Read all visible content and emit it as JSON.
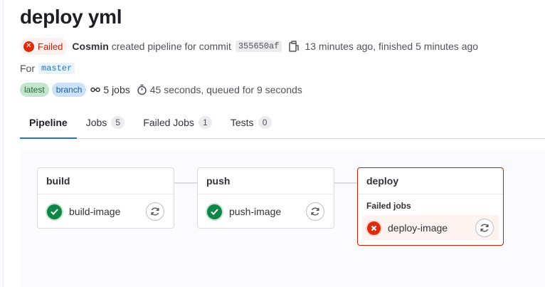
{
  "pipeline": {
    "title": "deploy yml",
    "status_label": "Failed",
    "author": "Cosmin",
    "action_text": "created pipeline for commit",
    "commit_sha": "355650af",
    "time_text": "13 minutes ago, finished 5 minutes ago",
    "for_label": "For",
    "ref": "master",
    "badges": [
      "latest",
      "branch"
    ],
    "jobs_count_text": "5 jobs",
    "duration_text": "45 seconds, queued for 9 seconds"
  },
  "tabs": [
    {
      "label": "Pipeline",
      "count": null,
      "active": true
    },
    {
      "label": "Jobs",
      "count": "5",
      "active": false
    },
    {
      "label": "Failed Jobs",
      "count": "1",
      "active": false
    },
    {
      "label": "Tests",
      "count": "0",
      "active": false
    }
  ],
  "stages": [
    {
      "name": "build",
      "jobs": [
        {
          "name": "build-image",
          "status": "success"
        }
      ]
    },
    {
      "name": "push",
      "jobs": [
        {
          "name": "push-image",
          "status": "success"
        }
      ]
    },
    {
      "name": "deploy",
      "subheading": "Failed jobs",
      "jobs": [
        {
          "name": "deploy-image",
          "status": "failed"
        }
      ]
    }
  ],
  "colors": {
    "success": "#108548",
    "failed": "#dd2b0e",
    "tab_active": "#1f75cb"
  },
  "icons": {
    "status": "x-circle-icon",
    "copy": "copy-icon",
    "jobs": "pipeline-icon",
    "duration": "timer-icon",
    "job_success": "check-circle-icon",
    "job_failed": "x-circle-icon",
    "retry": "retry-icon"
  }
}
